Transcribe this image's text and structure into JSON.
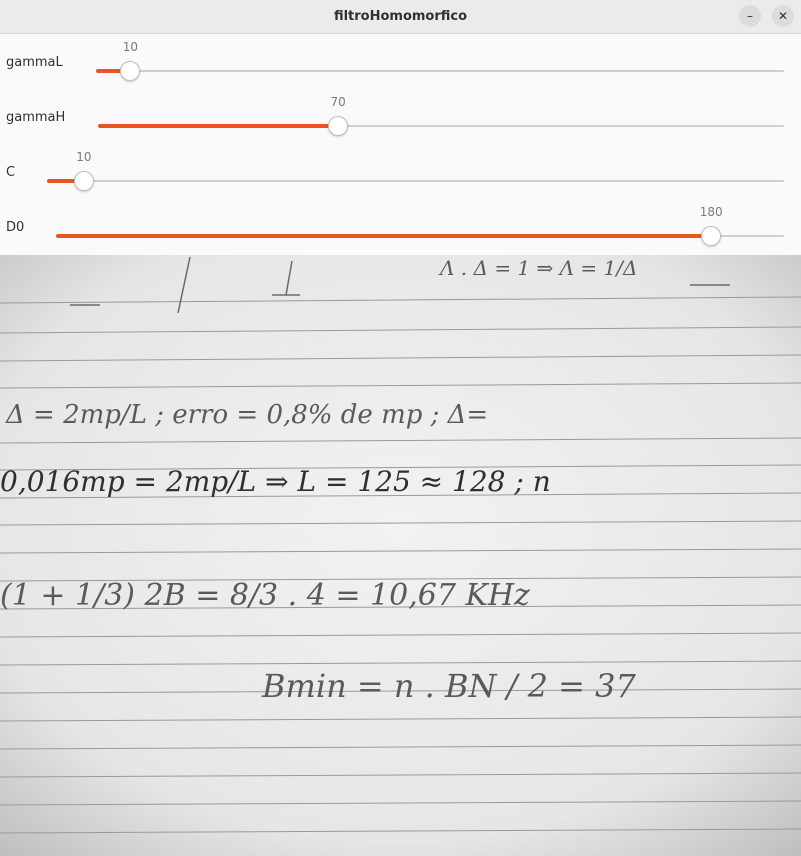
{
  "window": {
    "title": "filtroHomomorfico",
    "minimize_glyph": "–",
    "close_glyph": "✕"
  },
  "accent_color": "#e95420",
  "sliders": [
    {
      "label": "gammaL",
      "value": "10",
      "fraction": 0.05
    },
    {
      "label": "gammaH",
      "value": "70",
      "fraction": 0.35
    },
    {
      "label": "C",
      "value": "10",
      "fraction": 0.05
    },
    {
      "label": "D0",
      "value": "180",
      "fraction": 0.9
    }
  ],
  "image": {
    "lines": [
      "Λ . Δ = 1 ⇒ Λ = 1/Δ",
      "Δ = 2mp/L ; erro = 0,8% de mp ; Δ=",
      "0,016mp = 2mp/L ⇒ L = 125 ≈ 128 ; n",
      "(1 + 1/3) 2B = 8/3 . 4 = 10,67 KHz",
      "Bmin = n . BN / 2 = 37"
    ]
  }
}
